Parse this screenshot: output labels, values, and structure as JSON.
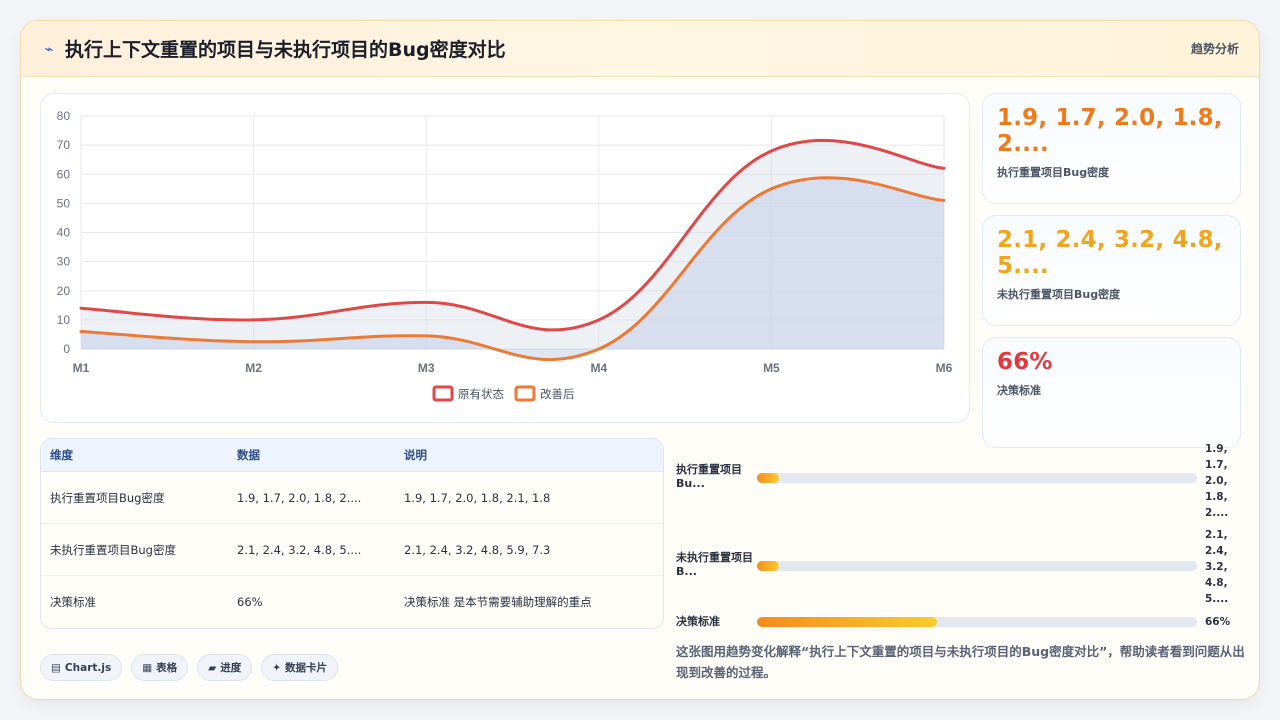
{
  "header": {
    "icon": "trend-icon",
    "title": "执行上下文重置的项目与未执行项目的Bug密度对比",
    "tag": "趋势分析"
  },
  "chart_data": {
    "type": "line",
    "title": "",
    "categories": [
      "M1",
      "M2",
      "M3",
      "M4",
      "M5",
      "M6"
    ],
    "series": [
      {
        "name": "原有状态",
        "values": [
          14,
          10,
          16,
          10,
          68,
          62
        ],
        "color": "#e04848"
      },
      {
        "name": "改善后",
        "values": [
          6,
          2.5,
          4.5,
          0,
          55,
          51
        ],
        "color": "#ec7a35"
      }
    ],
    "xlabel": "",
    "ylabel": "",
    "ylim": [
      0,
      80
    ],
    "yticks": [
      0,
      10,
      20,
      30,
      40,
      50,
      60,
      70,
      80
    ],
    "grid": true,
    "legend": "bottom",
    "fill": "area"
  },
  "stats": [
    {
      "value": "1.9, 1.7, 2.0, 1.8, 2....",
      "label": "执行重置项目Bug密度",
      "color": "#ef7a1a"
    },
    {
      "value": "2.1, 2.4, 3.2, 4.8, 5....",
      "label": "未执行重置项目Bug密度",
      "color": "#f2a51a"
    },
    {
      "value": "66%",
      "label": "决策标准",
      "color": "#e0383b"
    }
  ],
  "table": {
    "headers": [
      "维度",
      "数据",
      "说明"
    ],
    "rows": [
      [
        "执行重置项目Bug密度",
        "1.9, 1.7, 2.0, 1.8, 2....",
        "1.9, 1.7, 2.0, 1.8, 2.1, 1.8"
      ],
      [
        "未执行重置项目Bug密度",
        "2.1, 2.4, 3.2, 4.8, 5....",
        "2.1, 2.4, 3.2, 4.8, 5.9, 7.3"
      ],
      [
        "决策标准",
        "66%",
        "决策标准 是本节需要辅助理解的重点"
      ]
    ]
  },
  "pills": [
    {
      "icon": "chart-icon",
      "glyph": "▤",
      "label": "Chart.js"
    },
    {
      "icon": "table-icon",
      "glyph": "▦",
      "label": "表格"
    },
    {
      "icon": "progress-icon",
      "glyph": "▰",
      "label": "进度"
    },
    {
      "icon": "sparkle-icon",
      "glyph": "✦",
      "label": "数据卡片"
    }
  ],
  "progress": [
    {
      "label": "执行重置项目Bu...",
      "value": "1.9,\n1.7,\n2.0,\n1.8,\n2....",
      "fraction": 0.05
    },
    {
      "label": "未执行重置项目B...",
      "value": "2.1,\n2.4,\n3.2,\n4.8,\n5....",
      "fraction": 0.05
    },
    {
      "label": "决策标准",
      "value": "66%",
      "fraction": 0.41
    }
  ],
  "description": "这张图用趋势变化解释“执行上下文重置的项目与未执行项目的Bug密度对比”，帮助读者看到问题从出现到改善的过程。"
}
